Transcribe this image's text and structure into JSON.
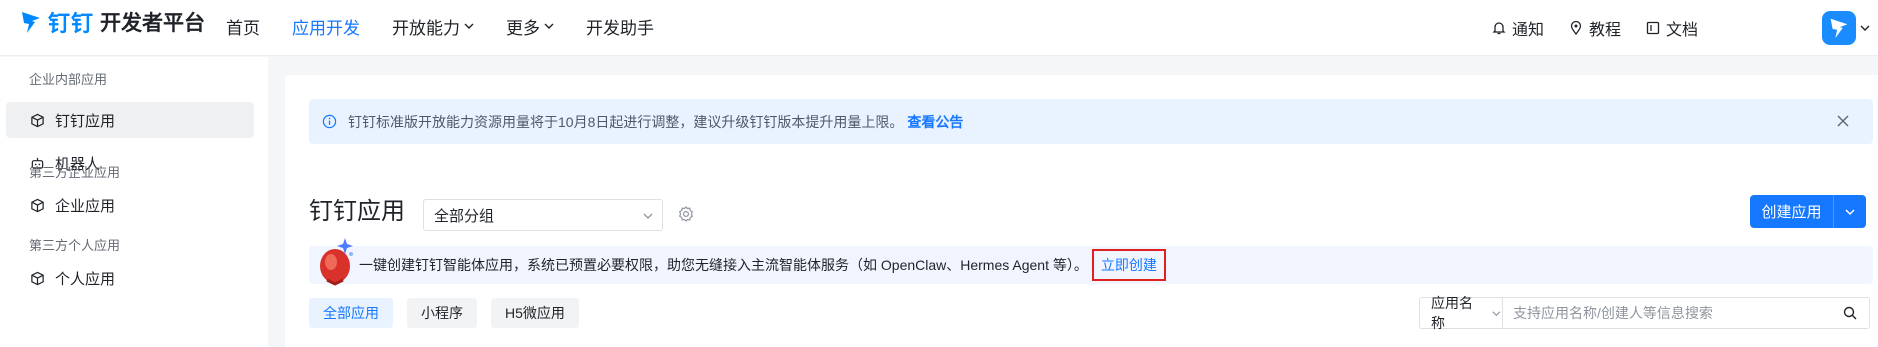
{
  "header": {
    "brand": "钉钉",
    "title": "开发者平台",
    "nav": [
      {
        "label": "首页",
        "active": false,
        "dropdown": false
      },
      {
        "label": "应用开发",
        "active": true,
        "dropdown": false
      },
      {
        "label": "开放能力",
        "active": false,
        "dropdown": true
      },
      {
        "label": "更多",
        "active": false,
        "dropdown": true
      },
      {
        "label": "开发助手",
        "active": false,
        "dropdown": false
      }
    ],
    "right": {
      "notify": "通知",
      "tutorial": "教程",
      "docs": "文档"
    }
  },
  "sidebar": {
    "groups": [
      {
        "title": "企业内部应用",
        "items": [
          {
            "label": "钉钉应用",
            "icon": "cube-icon",
            "active": true
          },
          {
            "label": "机器人",
            "icon": "robot-icon",
            "active": false
          }
        ]
      },
      {
        "title": "第三方企业应用",
        "items": [
          {
            "label": "企业应用",
            "icon": "cube-icon",
            "active": false
          }
        ]
      },
      {
        "title": "第三方个人应用",
        "items": [
          {
            "label": "个人应用",
            "icon": "cube-icon",
            "active": false
          }
        ]
      }
    ]
  },
  "main": {
    "notice": {
      "text": "钉钉标准版开放能力资源用量将于10月8日起进行调整，建议升级钉钉版本提升用量上限。",
      "link": "查看公告"
    },
    "section_title": "钉钉应用",
    "group_select": "全部分组",
    "create_button": "创建应用",
    "agent_banner": {
      "text": "一键创建钉钉智能体应用，系统已预置必要权限，助您无缝接入主流智能体服务（如 OpenClaw、Hermes Agent 等）。",
      "link": "立即创建"
    },
    "tabs": [
      {
        "label": "全部应用",
        "active": true
      },
      {
        "label": "小程序",
        "active": false
      },
      {
        "label": "H5微应用",
        "active": false
      }
    ],
    "search": {
      "field": "应用名称",
      "placeholder": "支持应用名称/创建人等信息搜索"
    }
  },
  "colors": {
    "accent": "#1677ff",
    "highlight_border": "#e02020",
    "notice_bg": "#e8f3ff"
  }
}
